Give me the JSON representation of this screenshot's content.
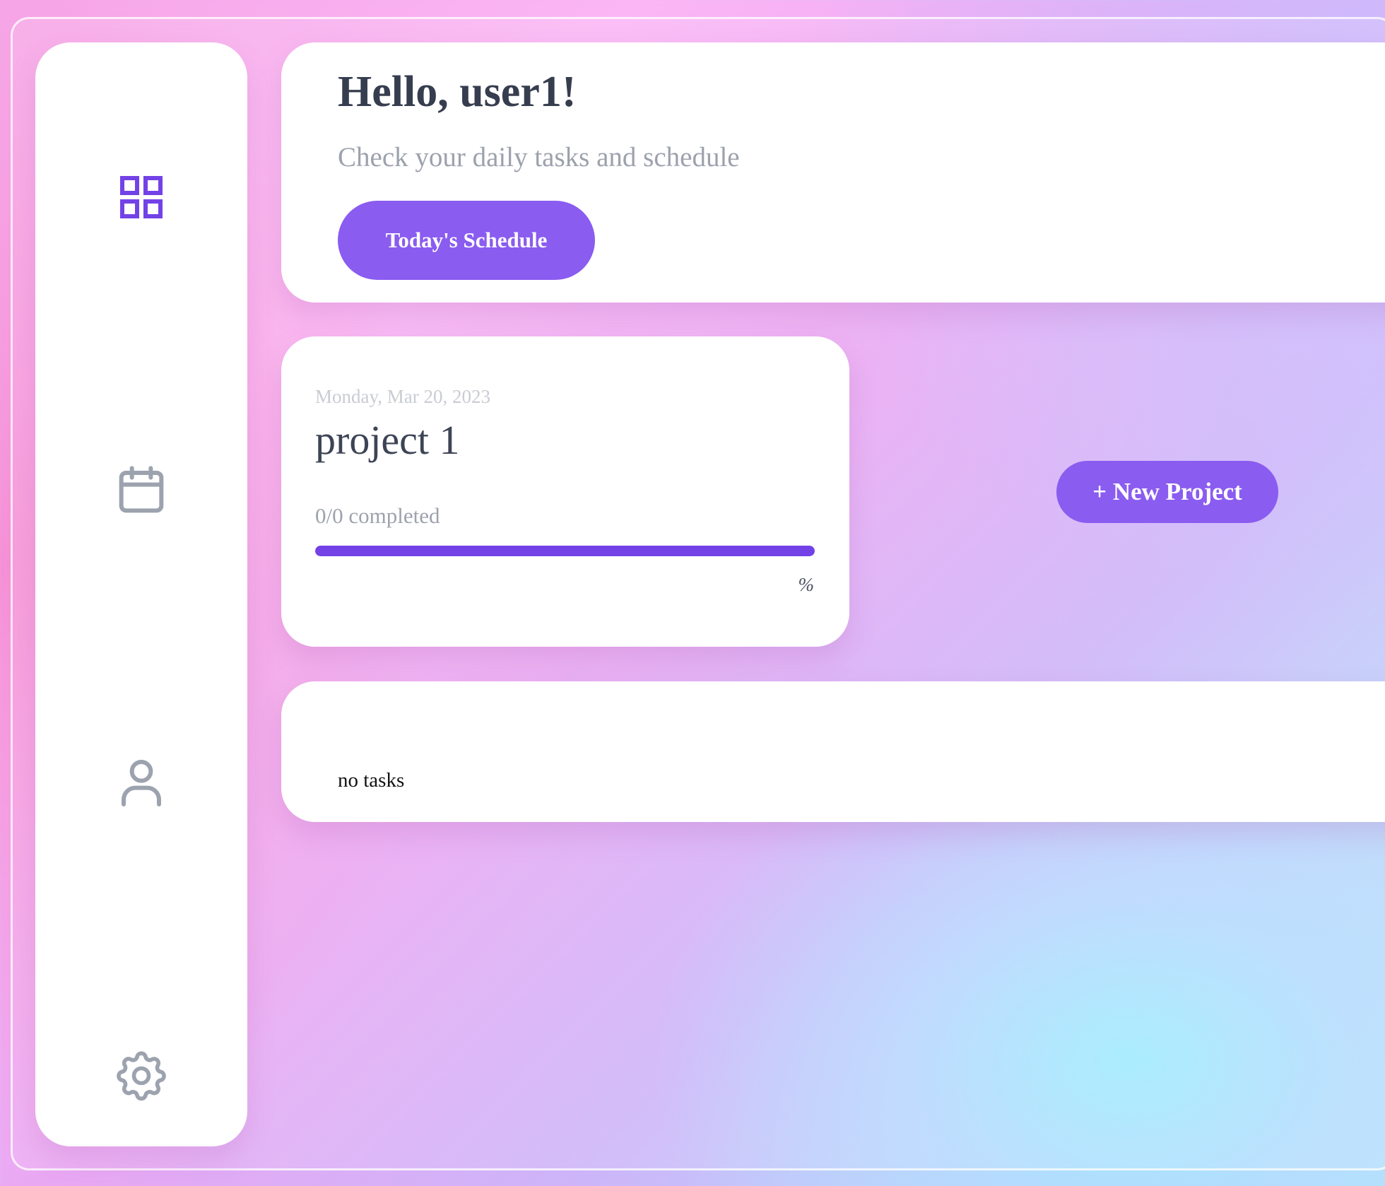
{
  "theme": {
    "accent": "#8a5cf0",
    "accent_dark": "#7342e6",
    "icon_inactive": "#9ca3af",
    "text_dark": "#363d4f",
    "text_muted": "#9ca1ad"
  },
  "sidebar": {
    "items": [
      {
        "icon": "dashboard-grid-icon",
        "active": true
      },
      {
        "icon": "calendar-icon",
        "active": false
      },
      {
        "icon": "user-icon",
        "active": false
      },
      {
        "icon": "gear-icon",
        "active": false
      }
    ]
  },
  "hero": {
    "title": "Hello, user1!",
    "subtitle": "Check your daily tasks and schedule",
    "schedule_button": "Today's Schedule"
  },
  "project": {
    "date": "Monday, Mar 20, 2023",
    "name": "project 1",
    "progress_text": "0/0 completed",
    "progress_fraction": 1.0,
    "percent_label": "%"
  },
  "actions": {
    "new_project_button": "+ New Project"
  },
  "tasks": {
    "empty_text": "no tasks"
  }
}
